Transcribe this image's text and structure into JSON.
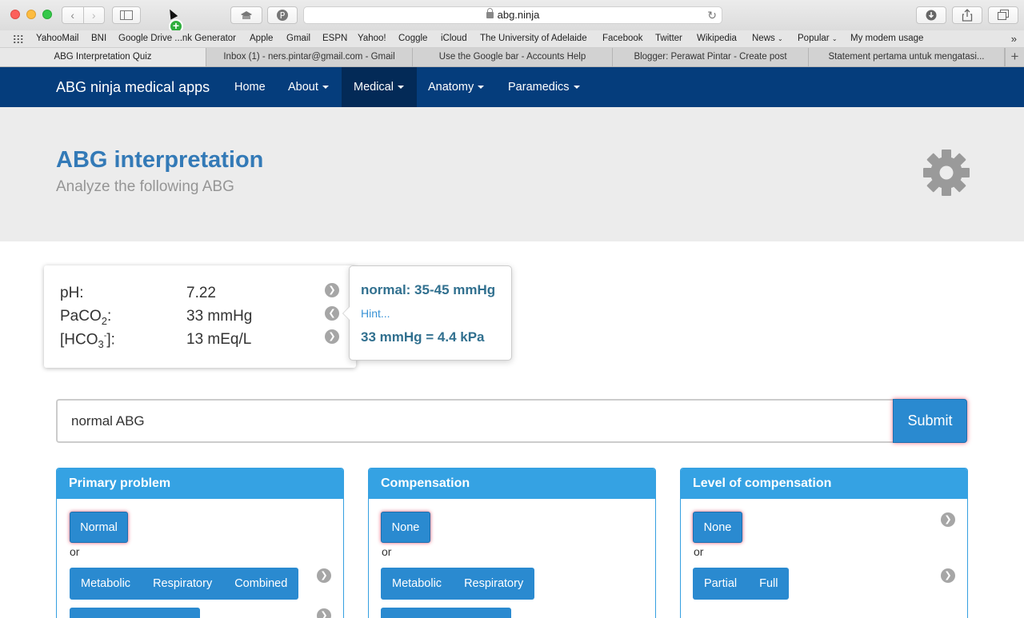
{
  "browser": {
    "address": "abg.ninja",
    "bookmarks": [
      "YahooMail",
      "BNI",
      "Google Drive ...nk Generator",
      "Apple",
      "Gmail",
      "ESPN",
      "Yahoo!",
      "Coggle",
      "iCloud",
      "The University of Adelaide",
      "Facebook",
      "Twitter",
      "Wikipedia",
      "News",
      "Popular",
      "My modem usage"
    ],
    "tabs": [
      {
        "label": "ABG Interpretation Quiz",
        "active": true
      },
      {
        "label": "Inbox (1) - ners.pintar@gmail.com - Gmail"
      },
      {
        "label": "Use the Google bar - Accounts Help"
      },
      {
        "label": "Blogger: Perawat Pintar - Create post"
      },
      {
        "label": "Statement pertama untuk mengatasi..."
      }
    ]
  },
  "navbar": {
    "brand": "ABG ninja medical apps",
    "items": [
      {
        "label": "Home"
      },
      {
        "label": "About"
      },
      {
        "label": "Medical",
        "active": true
      },
      {
        "label": "Anatomy"
      },
      {
        "label": "Paramedics"
      }
    ]
  },
  "header": {
    "title": "ABG interpretation",
    "subtitle": "Analyze the following ABG"
  },
  "abg": {
    "ph_label": "pH:",
    "ph_value": "7.22",
    "paco2_label": "PaCO",
    "paco2_sub": "2",
    "paco2_colon": ":",
    "paco2_value": "33 mmHg",
    "hco3_label": "[HCO",
    "hco3_sub": "3",
    "hco3_sup": "-",
    "hco3_close": "]:",
    "hco3_value": "13 mEq/L"
  },
  "popover": {
    "normal": "normal: 35-45 mmHg",
    "hint": "Hint...",
    "conversion": "33 mmHg = 4.4 kPa"
  },
  "answer": {
    "value": "normal ABG",
    "submit": "Submit"
  },
  "panels": {
    "primary": {
      "title": "Primary problem",
      "selected": "Normal",
      "or": "or",
      "options": [
        "Metabolic",
        "Respiratory",
        "Combined"
      ]
    },
    "compensation": {
      "title": "Compensation",
      "selected": "None",
      "or": "or",
      "options": [
        "Metabolic",
        "Respiratory"
      ]
    },
    "level": {
      "title": "Level of compensation",
      "selected": "None",
      "or": "or",
      "options": [
        "Partial",
        "Full"
      ]
    }
  },
  "colors": {
    "navbar": "#053d7c",
    "title": "#337ab7",
    "button": "#2a8ad0",
    "panel_header": "#35a2e3"
  }
}
